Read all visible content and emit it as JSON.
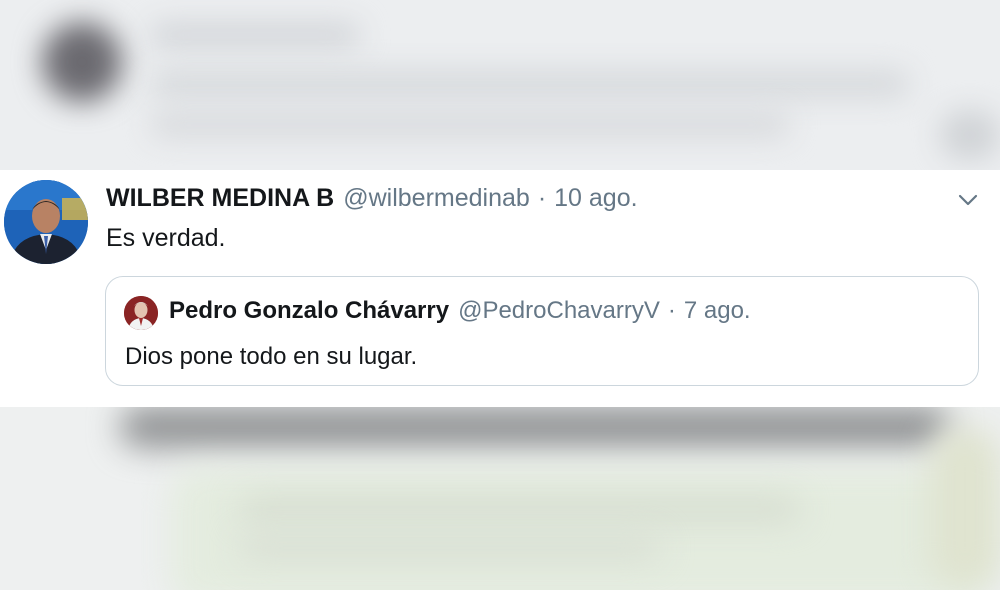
{
  "tweet": {
    "author_name": "WILBER MEDINA B",
    "handle": "@wilbermedinab",
    "separator": "·",
    "date": "10 ago.",
    "text": "Es verdad."
  },
  "quoted_tweet": {
    "author_name": "Pedro Gonzalo Chávarry",
    "handle": "@PedroChavarryV",
    "separator": "·",
    "date": "7 ago.",
    "text": "Dios pone todo en su lugar."
  },
  "colors": {
    "text_primary": "#14171a",
    "text_secondary": "#657786",
    "border": "#ccd6dd"
  },
  "icons": {
    "menu": "chevron-down-icon"
  }
}
